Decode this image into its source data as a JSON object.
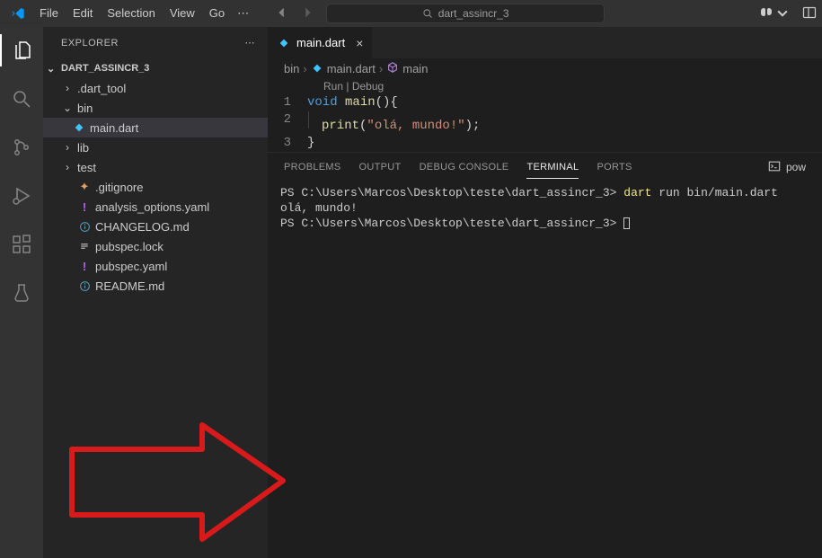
{
  "menu": {
    "file": "File",
    "edit": "Edit",
    "selection": "Selection",
    "view": "View",
    "go": "Go"
  },
  "search": {
    "text": "dart_assincr_3"
  },
  "explorer": {
    "title": "EXPLORER",
    "workspace": "DART_ASSINCR_3",
    "nodes": {
      "dart_tool": ".dart_tool",
      "bin": "bin",
      "maindart": "main.dart",
      "lib": "lib",
      "test": "test",
      "gitignore": ".gitignore",
      "analysis": "analysis_options.yaml",
      "changelog": "CHANGELOG.md",
      "publock": "pubspec.lock",
      "pubyaml": "pubspec.yaml",
      "readme": "README.md"
    }
  },
  "tab": {
    "filename": "main.dart"
  },
  "breadcrumbs": {
    "bin": "bin",
    "file": "main.dart",
    "symbol": "main"
  },
  "codelens": {
    "run": "Run",
    "debug": "Debug",
    "sep": " | "
  },
  "code": {
    "l1a": "void",
    "l1b": " main",
    "l1c": "(){",
    "l2a": "print",
    "l2b": "(",
    "l2c": "\"olá, mundo!\"",
    "l2d": ");",
    "l3": "}"
  },
  "lines": {
    "n1": "1",
    "n2": "2",
    "n3": "3"
  },
  "panel": {
    "problems": "PROBLEMS",
    "output": "OUTPUT",
    "debug": "DEBUG CONSOLE",
    "terminal": "TERMINAL",
    "ports": "PORTS",
    "shell": "pow"
  },
  "term": {
    "prompt1": "PS C:\\Users\\Marcos\\Desktop\\teste\\dart_assincr_3> ",
    "cmd": "dart",
    "args": " run bin/main.dart",
    "out": "olá, mundo!",
    "prompt2": "PS C:\\Users\\Marcos\\Desktop\\teste\\dart_assincr_3> "
  }
}
